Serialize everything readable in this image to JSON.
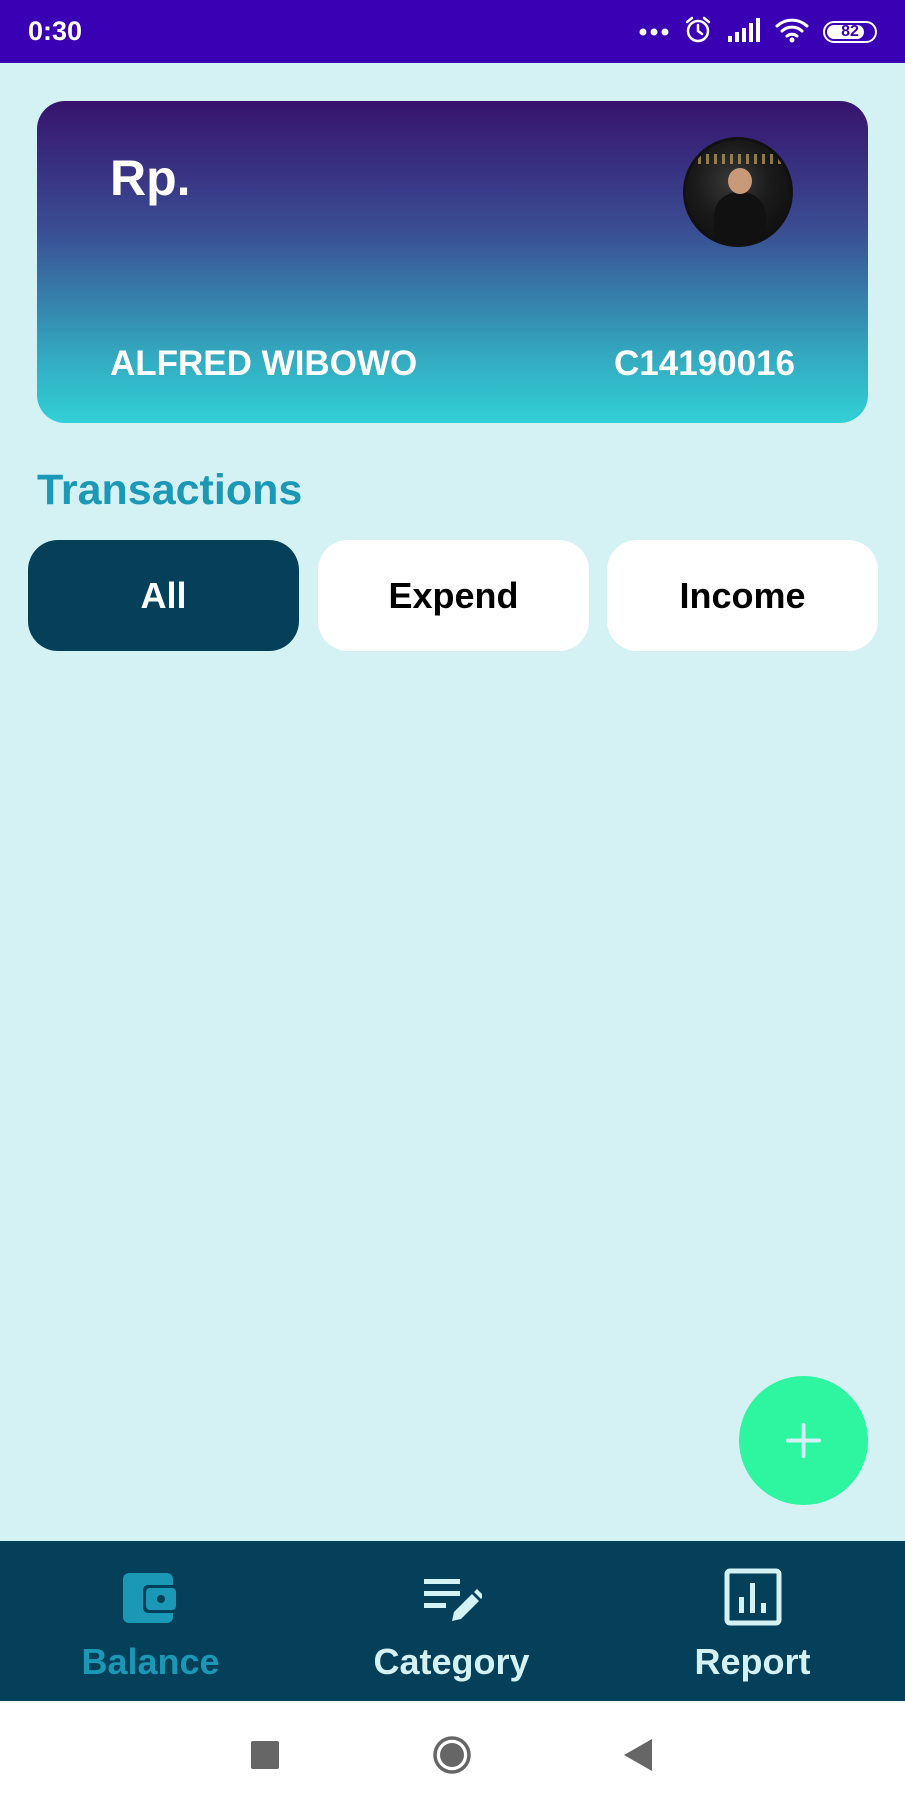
{
  "status_bar": {
    "time": "0:30",
    "battery_level": "82",
    "icons": [
      "more-dots-icon",
      "alarm-icon",
      "signal-icon",
      "wifi-icon",
      "battery-icon"
    ],
    "background": "#3a00b4"
  },
  "card": {
    "currency": "Rp.",
    "account_name": "ALFRED WIBOWO",
    "account_id": "C14190016",
    "gradient_colors": [
      "#37136e",
      "#3a4d93",
      "#33a7be",
      "#32d0d6"
    ]
  },
  "transactions": {
    "title": "Transactions",
    "filters": [
      {
        "label": "All",
        "active": true
      },
      {
        "label": "Expend",
        "active": false
      },
      {
        "label": "Income",
        "active": false
      }
    ]
  },
  "fab": {
    "icon": "plus-icon",
    "color": "#2ef59f"
  },
  "bottom_nav": {
    "items": [
      {
        "label": "Balance",
        "icon": "wallet-icon",
        "active": true
      },
      {
        "label": "Category",
        "icon": "edit-list-icon",
        "active": false
      },
      {
        "label": "Report",
        "icon": "bar-chart-icon",
        "active": false
      }
    ],
    "background": "#04405a",
    "active_color": "#1a98b5"
  },
  "system_nav": {
    "buttons": [
      "recent-apps-icon",
      "home-icon",
      "back-icon"
    ]
  },
  "colors": {
    "page_background": "#d4f1f4",
    "title_accent": "#1a98b5",
    "active_filter": "#04405a"
  }
}
